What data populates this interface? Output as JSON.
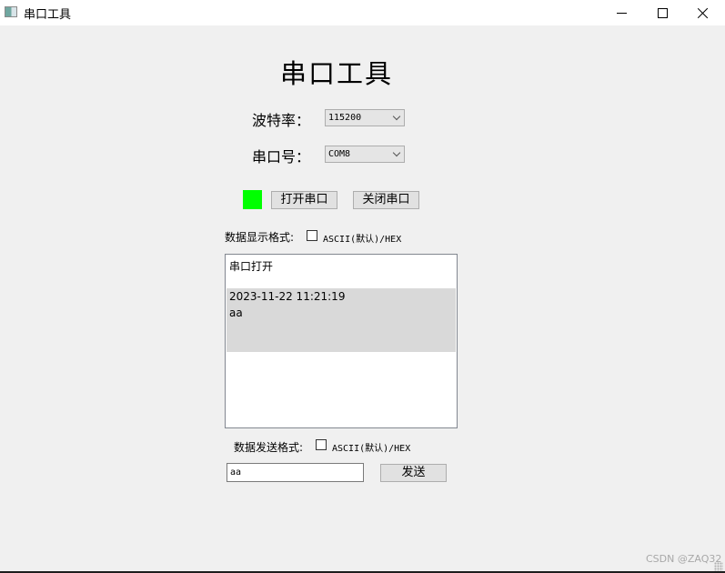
{
  "window": {
    "title": "串口工具",
    "controls": {
      "minimize": "minimize",
      "maximize": "maximize",
      "close": "close"
    }
  },
  "main": {
    "heading": "串口工具",
    "baud_rate": {
      "label": "波特率：",
      "value": "115200"
    },
    "port": {
      "label": "串口号：",
      "value": "COM8"
    },
    "status_led_color": "#00ff00",
    "open_button": "打开串口",
    "close_button": "关闭串口",
    "display_format": {
      "label": "数据显示格式:",
      "checkbox_label": "ASCII(默认)/HEX",
      "checked": false
    },
    "display_log": [
      {
        "text": "串口打开"
      },
      {
        "text": "2023-11-22 11:21:19"
      },
      {
        "text": "aa"
      }
    ],
    "send_format": {
      "label": "数据发送格式:",
      "checkbox_label": "ASCII(默认)/HEX",
      "checked": false
    },
    "send_input_value": "aa",
    "send_button": "发送"
  },
  "watermark": "CSDN @ZAQ32"
}
